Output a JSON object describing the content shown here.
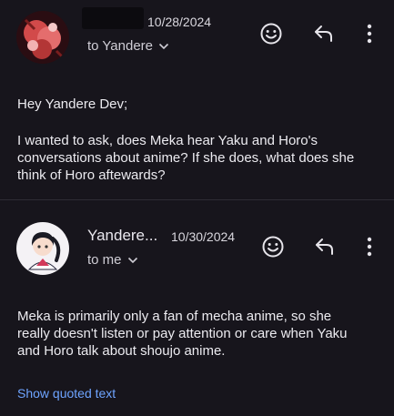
{
  "message1": {
    "date": "10/28/2024",
    "recipient": "to Yandere",
    "greeting": "Hey Yandere Dev;",
    "body": "I wanted to ask, does Meka hear Yaku and Horo's conversations about anime? If she does, what does she think of Horo aftewards?"
  },
  "message2": {
    "sender": "Yandere...",
    "date": "10/30/2024",
    "recipient": "to me",
    "body": "Meka is primarily only a fan of mecha anime, so she really doesn't listen or pay attention or care when Yaku and Horo talk about shoujo anime.",
    "show_quoted": "Show quoted text"
  },
  "icons": {
    "emoji": "smile-emoji-icon",
    "reply": "reply-icon",
    "more": "more-vertical-icon",
    "chevron": "chevron-down-icon"
  },
  "colors": {
    "background": "#17151c",
    "link": "#6ea4ff",
    "text": "#e9e7ee"
  }
}
